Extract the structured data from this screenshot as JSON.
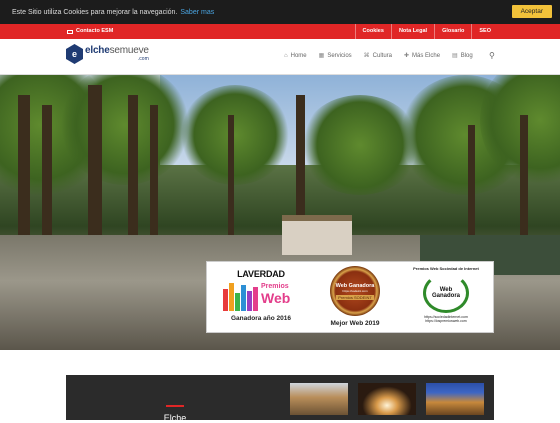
{
  "cookie_bar": {
    "text": "Este Sitio utiliza Cookies para mejorar la navegación.",
    "link": "Saber mas",
    "accept_label": "Aceptar"
  },
  "topbar": {
    "contact": "Contacto ESM",
    "links": [
      "Cookies",
      "Nota Legal",
      "Glosario",
      "SEO"
    ]
  },
  "logo": {
    "main_bold": "elche",
    "main_light": "semueve",
    "sub": ".com"
  },
  "nav": {
    "items": [
      {
        "label": "Home",
        "icon": "home-icon"
      },
      {
        "label": "Servicios",
        "icon": "film-icon"
      },
      {
        "label": "Cultura",
        "icon": "building-icon"
      },
      {
        "label": "Más Elche",
        "icon": "plus-icon"
      },
      {
        "label": "Blog",
        "icon": "document-icon"
      }
    ],
    "search_icon": "search-icon"
  },
  "awards": {
    "laverdad": {
      "brand": "LAVERDAD",
      "line1": "Premios",
      "line2": "Web",
      "caption": "Ganadora año 2016"
    },
    "sodeint": {
      "line1": "Web Ganadora",
      "line2": "https://sodeint.com",
      "line3": "Premios SODEINT",
      "caption": "Mejor Web 2019"
    },
    "sociedad": {
      "title": "Premios Web Sociedad de Internet",
      "line1": "Web",
      "line2": "Ganadora",
      "url1": "https://sociedadinternet.com",
      "url2": "https://lospremiosweb.com"
    }
  },
  "section": {
    "title": "Elche"
  },
  "colors": {
    "accent_red": "#e02626",
    "brand_navy": "#1f3b73",
    "accept_yellow": "#f2c23a"
  }
}
